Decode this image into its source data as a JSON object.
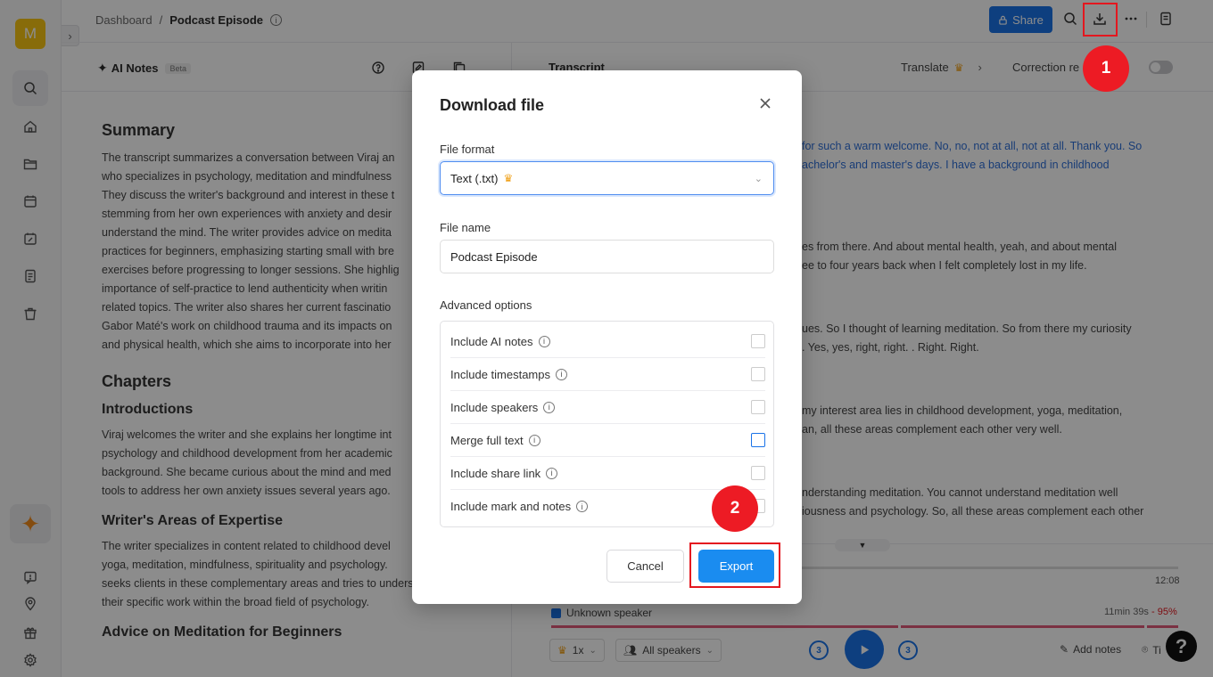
{
  "app": {
    "avatar_letter": "M",
    "accent_color": "#1a73e8"
  },
  "breadcrumb": {
    "root": "Dashboard",
    "separator": "/",
    "current": "Podcast Episode"
  },
  "topbar": {
    "share_label": "Share"
  },
  "notes_panel": {
    "title": "AI Notes",
    "beta_label": "Beta",
    "summary_heading": "Summary",
    "summary_lines": [
      "The transcript summarizes a conversation between Viraj an",
      "who specializes in psychology, meditation and mindfulness",
      "They discuss the writer's background and interest in these t",
      "stemming from her own experiences with anxiety and desir",
      "understand the mind. The writer provides advice on medita",
      "practices for beginners, emphasizing starting small with bre",
      "exercises before progressing to longer sessions. She highlig",
      "importance of self-practice to lend authenticity when writin",
      "related topics. The writer also shares her current fascinatio",
      "Gabor Maté's work on childhood trauma and its impacts on",
      "and physical health, which she aims to incorporate into her"
    ],
    "chapters_heading": "Chapters",
    "chapter1_heading": "Introductions",
    "chapter1_lines": [
      "Viraj welcomes the writer and she explains her longtime int",
      "psychology and childhood development from her academic",
      "background. She became curious about the mind and med",
      "tools to address her own anxiety issues several years ago."
    ],
    "chapter2_heading": "Writer's Areas of Expertise",
    "chapter2_lines": [
      "The writer specializes in content related to childhood devel",
      "yoga, meditation, mindfulness, spirituality and psychology.",
      "seeks clients in these complementary areas and tries to understand",
      "their specific work within the broad field of psychology."
    ],
    "chapter3_heading": "Advice on Meditation for Beginners"
  },
  "transcript_panel": {
    "title": "Transcript",
    "translate_label": "Translate",
    "correction_label": "Correction re",
    "lines": [
      "for such a warm welcome. No, no, not at all, not at all. Thank you. So",
      "achelor's and master's days. I have a background in childhood",
      "es from there. And about mental health, yeah, and about mental",
      "ee to four years back when I felt completely lost in my life.",
      "ues. So I thought of learning meditation. So from there my curiosity",
      ". Yes, yes, right, right. . Right. Right.",
      "my interest area lies in childhood development, yoga, meditation,",
      "an, all these areas complement each other very well.",
      "nderstanding meditation. You cannot understand meditation well",
      "iousness and psychology. So, all these areas complement each other"
    ]
  },
  "player": {
    "end_time": "12:08",
    "speaker_name": "Unknown speaker",
    "speaker_duration": "11min 39s",
    "speaker_percent": "- 95%",
    "speed_label": "1x",
    "speakers_filter": "All speakers",
    "skip_back": "3",
    "skip_forward": "3",
    "add_notes_label": "Add notes",
    "extra_label": "Ti",
    "help_label": "?"
  },
  "download_modal": {
    "title": "Download file",
    "file_format_label": "File format",
    "file_format_value": "Text (.txt)",
    "file_name_label": "File name",
    "file_name_value": "Podcast Episode",
    "advanced_label": "Advanced options",
    "options": [
      {
        "label": "Include AI notes",
        "checked": false
      },
      {
        "label": "Include timestamps",
        "checked": false
      },
      {
        "label": "Include speakers",
        "checked": false
      },
      {
        "label": "Merge full text",
        "checked": false
      },
      {
        "label": "Include share link",
        "checked": false
      },
      {
        "label": "Include mark and notes",
        "checked": false
      }
    ],
    "cancel_label": "Cancel",
    "export_label": "Export"
  },
  "annotations": {
    "step1": "1",
    "step2": "2",
    "highlight_color": "#e4171f"
  }
}
